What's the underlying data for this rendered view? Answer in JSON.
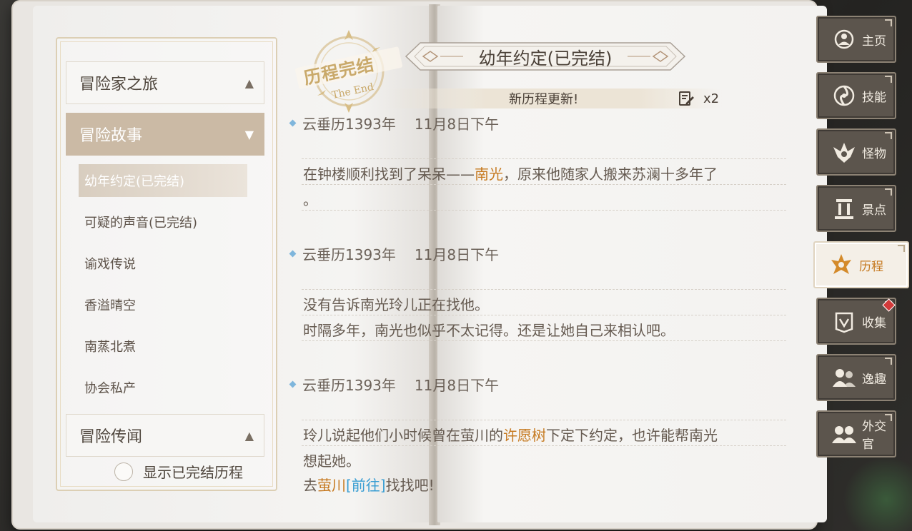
{
  "left_panel": {
    "categories": [
      {
        "label": "冒险家之旅",
        "chevron": "▲"
      },
      {
        "label": "冒险故事",
        "chevron": "▼"
      },
      {
        "label": "冒险传闻",
        "chevron": "▲"
      }
    ],
    "sub_items": [
      {
        "label": "幼年约定(已完结)"
      },
      {
        "label": "可疑的声音(已完结)"
      },
      {
        "label": "谕戏传说"
      },
      {
        "label": "香溢晴空"
      },
      {
        "label": "南蒸北煮"
      },
      {
        "label": "协会私产"
      }
    ],
    "toggle_label": "显示已完结历程"
  },
  "stamp": {
    "line1": "历程完结",
    "line2": "The End"
  },
  "header": {
    "title": "幼年约定(已完结)",
    "update_text": "新历程更新!",
    "update_multiplier": "x2"
  },
  "entries": [
    {
      "date": "云垂历1393年",
      "time": "11月8日下午",
      "lines": [
        [
          {
            "t": "在钟楼顺利找到了呆呆——"
          },
          {
            "t": "南光",
            "c": "hl"
          },
          {
            "t": "，原来他随家人搬来苏澜十多年了"
          }
        ],
        [
          {
            "t": "。"
          }
        ]
      ]
    },
    {
      "date": "云垂历1393年",
      "time": "11月8日下午",
      "lines": [
        [
          {
            "t": "没有告诉南光玲儿正在找他。"
          }
        ],
        [
          {
            "t": "时隔多年，南光也似乎不太记得。还是让她自己来相认吧。"
          }
        ]
      ]
    },
    {
      "date": "云垂历1393年",
      "time": "11月8日下午",
      "lines": [
        [
          {
            "t": "玲儿说起他们小时候曾在萤川的"
          },
          {
            "t": "许愿树",
            "c": "hl"
          },
          {
            "t": "下定下约定，也许能帮南光"
          }
        ],
        [
          {
            "t": "想起她。"
          }
        ],
        [
          {
            "t": "去"
          },
          {
            "t": "萤川",
            "c": "hl"
          },
          {
            "t": "[前往]",
            "c": "link"
          },
          {
            "t": "找找吧!"
          }
        ]
      ]
    }
  ],
  "right_tabs": [
    {
      "label": "主页",
      "icon": "home-icon"
    },
    {
      "label": "技能",
      "icon": "skill-icon"
    },
    {
      "label": "怪物",
      "icon": "monster-icon"
    },
    {
      "label": "景点",
      "icon": "landmark-icon"
    },
    {
      "label": "历程",
      "icon": "journey-icon",
      "active": true
    },
    {
      "label": "收集",
      "icon": "collection-icon",
      "badge": true
    },
    {
      "label": "逸趣",
      "icon": "fun-icon"
    },
    {
      "label": "外交官",
      "icon": "diplomat-icon"
    }
  ],
  "colors": {
    "highlight": "#c67a21",
    "link": "#3a9ed3",
    "active_tab_bg": "#f4efe7",
    "tab_bg": "#5c554d"
  }
}
